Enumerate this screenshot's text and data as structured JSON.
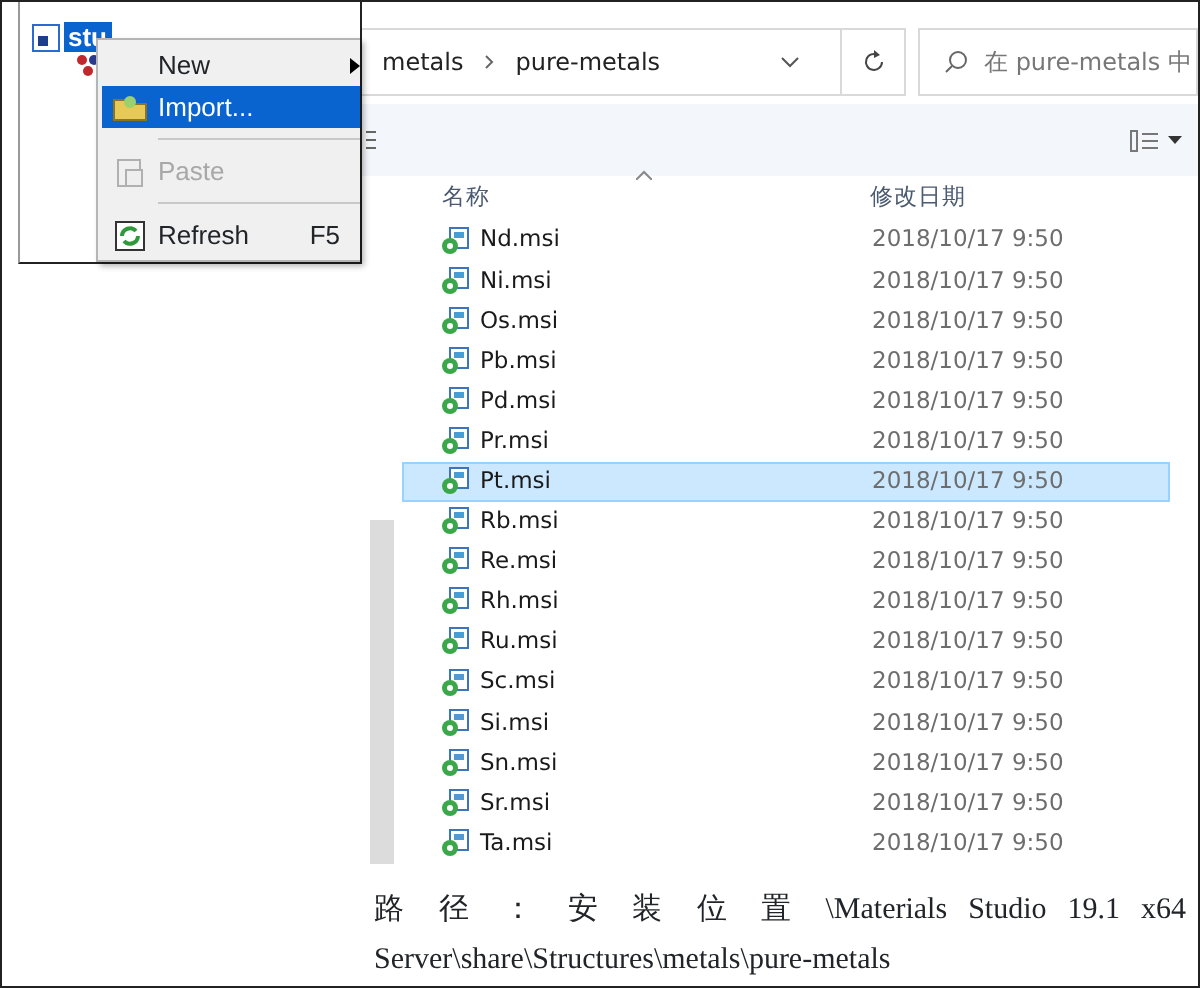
{
  "tree": {
    "item": "stu"
  },
  "context_menu": {
    "items": [
      {
        "kind": "submenu",
        "label": "New",
        "selected": false,
        "disabled": false
      },
      {
        "kind": "item",
        "label": "Import...",
        "selected": true,
        "disabled": false
      },
      {
        "kind": "item",
        "label": "Paste",
        "selected": false,
        "disabled": true
      },
      {
        "kind": "item",
        "label": "Refresh",
        "shortcut": "F5",
        "selected": false,
        "disabled": false
      }
    ]
  },
  "explorer": {
    "breadcrumb": [
      "metals",
      "pure-metals"
    ],
    "search": {
      "placeholder": "在 pure-metals 中"
    },
    "columns": [
      "名称",
      "修改日期"
    ],
    "files": [
      {
        "name": "Nd.msi",
        "modified": "2018/10/17 9:50",
        "selected": false
      },
      {
        "name": "Ni.msi",
        "modified": "2018/10/17 9:50",
        "selected": false
      },
      {
        "name": "Os.msi",
        "modified": "2018/10/17 9:50",
        "selected": false
      },
      {
        "name": "Pb.msi",
        "modified": "2018/10/17 9:50",
        "selected": false
      },
      {
        "name": "Pd.msi",
        "modified": "2018/10/17 9:50",
        "selected": false
      },
      {
        "name": "Pr.msi",
        "modified": "2018/10/17 9:50",
        "selected": false
      },
      {
        "name": "Pt.msi",
        "modified": "2018/10/17 9:50",
        "selected": true
      },
      {
        "name": "Rb.msi",
        "modified": "2018/10/17 9:50",
        "selected": false
      },
      {
        "name": "Re.msi",
        "modified": "2018/10/17 9:50",
        "selected": false
      },
      {
        "name": "Rh.msi",
        "modified": "2018/10/17 9:50",
        "selected": false
      },
      {
        "name": "Ru.msi",
        "modified": "2018/10/17 9:50",
        "selected": false
      },
      {
        "name": "Sc.msi",
        "modified": "2018/10/17 9:50",
        "selected": false
      },
      {
        "name": "Si.msi",
        "modified": "2018/10/17 9:50",
        "selected": false
      },
      {
        "name": "Sn.msi",
        "modified": "2018/10/17 9:50",
        "selected": false
      },
      {
        "name": "Sr.msi",
        "modified": "2018/10/17 9:50",
        "selected": false
      },
      {
        "name": "Ta.msi",
        "modified": "2018/10/17 9:50",
        "selected": false
      }
    ]
  },
  "caption": "路 径 ： 安 装 位 置 \\Materials Studio 19.1 x64 Server\\share\\Structures\\metals\\pure-metals"
}
